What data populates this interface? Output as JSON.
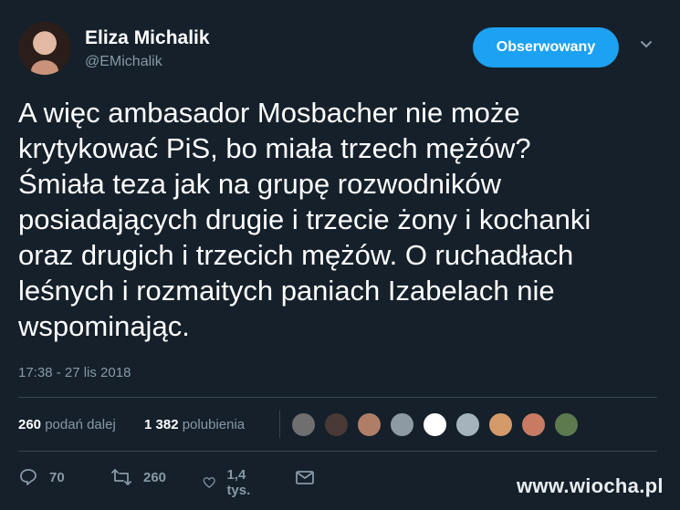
{
  "author": {
    "name": "Eliza Michalik",
    "handle": "@EMichalik"
  },
  "follow_button": {
    "label": "Obserwowany"
  },
  "tweet": {
    "text": "A więc ambasador Mosbacher nie może\nkrytykować PiS, bo miała trzech mężów?\nŚmiała teza jak na grupę rozwodników\nposiadających drugie i trzecie żony i kochanki\noraz drugich i trzecich mężów. O ruchadłach\nleśnych i rozmaitych paniach Izabelach nie\nwspominając.",
    "timestamp": "17:38 - 27 lis 2018"
  },
  "stats": {
    "retweets_count": "260",
    "retweets_label": "podań dalej",
    "likes_count": "1 382",
    "likes_label": "polubienia"
  },
  "liker_colors": [
    "#6f6f6f",
    "#4a3a35",
    "#b07e66",
    "#8e9aa3",
    "#ffffff",
    "#a5b3bd",
    "#d49a6a",
    "#c77b62",
    "#5c7a4e"
  ],
  "actions": {
    "replies": "70",
    "retweets": "260",
    "likes": "1,4 tys."
  },
  "icons": [
    "reply-icon",
    "retweet-icon",
    "like-icon",
    "message-icon",
    "chevron-down-icon"
  ],
  "colors": {
    "accent": "#1da1f2",
    "background": "#15202b",
    "muted": "#8899a6"
  },
  "watermark": "www.wiocha.pl"
}
